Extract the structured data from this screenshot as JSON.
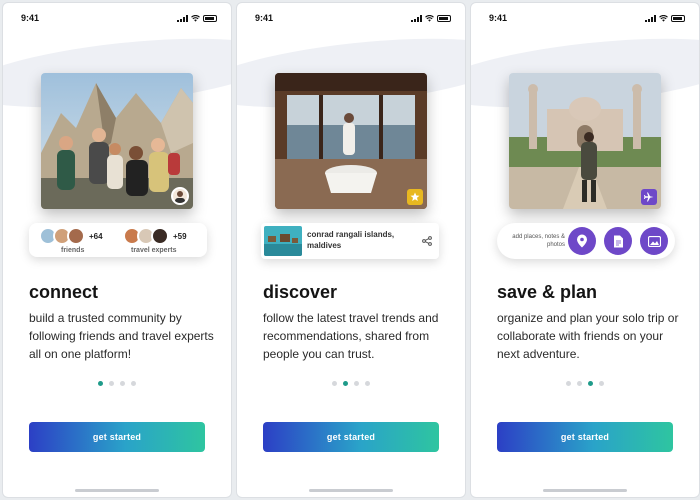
{
  "status_time": "9:41",
  "screens": [
    {
      "title": "connect",
      "description": "build a trusted community by following friends and travel experts all on one platform!",
      "friends_count": "+64",
      "friends_label": "friends",
      "experts_count": "+59",
      "experts_label": "travel experts",
      "active_dot": 0,
      "cta": "get started"
    },
    {
      "title": "discover",
      "description": "follow the latest travel trends and recommendations, shared from people you can trust.",
      "place_name": "conrad rangali islands, maldives",
      "active_dot": 1,
      "cta": "get started"
    },
    {
      "title": "save & plan",
      "description": "organize and plan your solo trip or collaborate with friends on your next adventure.",
      "add_label": "add places, notes & photos",
      "active_dot": 2,
      "cta": "get started"
    }
  ],
  "colors": {
    "accent_purple": "#6e48c8",
    "dot_active": "#1f9b8a",
    "badge_yellow": "#e8b820",
    "gradient_start": "#2c3fc5",
    "gradient_end": "#2ec5a0"
  },
  "icons": {
    "badge_screen1": "avatar-icon",
    "badge_screen2": "star-icon",
    "badge_screen3": "plane-icon",
    "share": "share-icon",
    "round_buttons": [
      "location-pin-icon",
      "note-icon",
      "photo-icon"
    ]
  }
}
